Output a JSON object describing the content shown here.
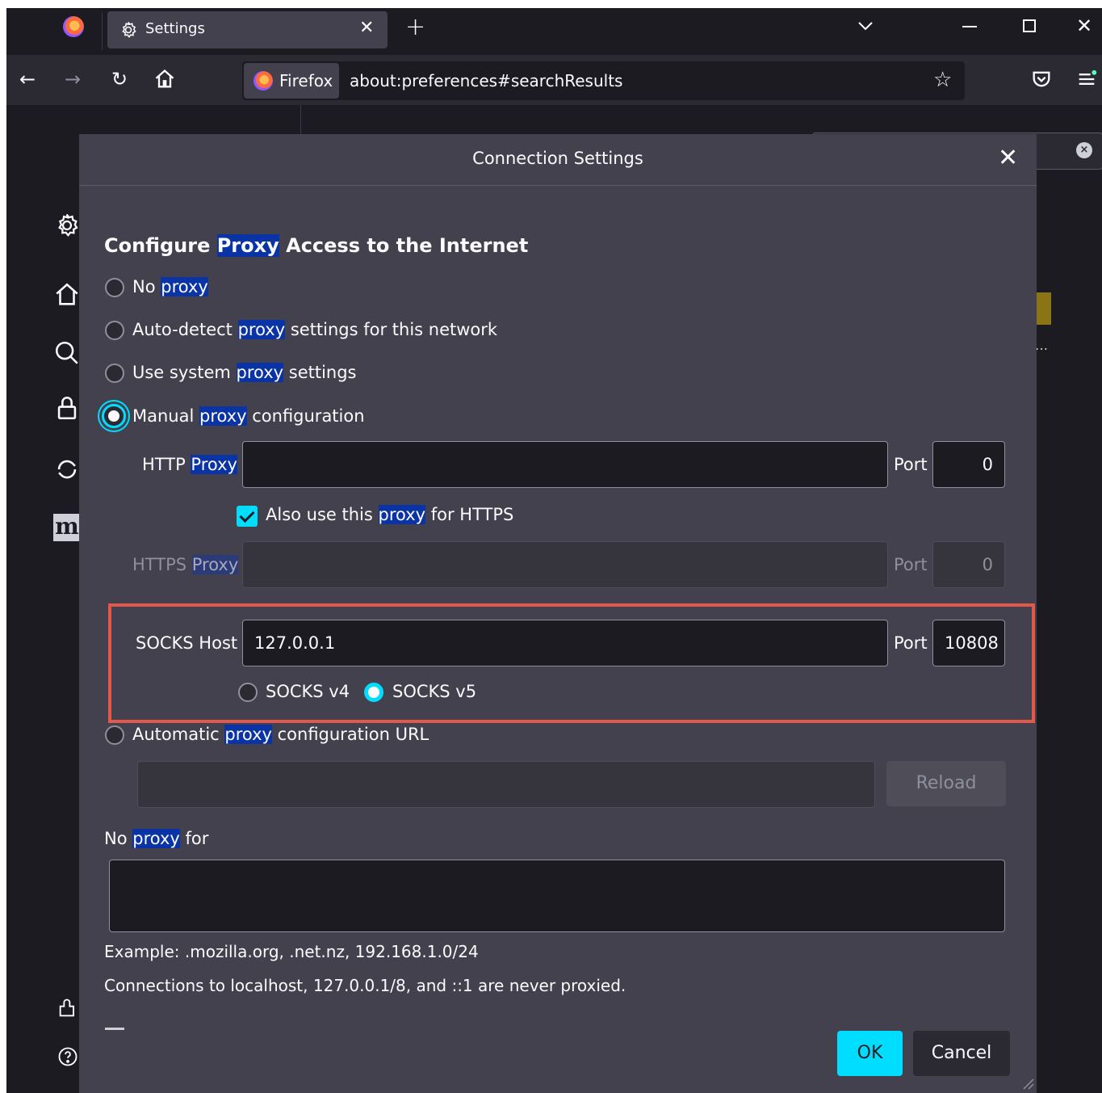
{
  "browser": {
    "tab_title": "Settings",
    "identity_label": "Firefox",
    "url": "about:preferences#searchResults"
  },
  "dialog": {
    "title": "Connection Settings",
    "heading": {
      "pre": "Configure ",
      "hl": "Proxy",
      "post": " Access to the Internet"
    },
    "no_proxy": {
      "pre": "No ",
      "hl": "proxy"
    },
    "auto_detect": {
      "pre": "Auto-detect ",
      "hl": "proxy",
      "post": " settings for this network"
    },
    "use_system": {
      "pre": "Use system ",
      "hl": "proxy",
      "post": " settings"
    },
    "manual": {
      "pre": "Manual ",
      "hl": "proxy",
      "post": " configuration",
      "selected": true
    },
    "http_proxy": {
      "pre": "HTTP ",
      "hl": "Proxy",
      "value": "",
      "port_label": "Port",
      "port": "0"
    },
    "also_https": {
      "pre": "Also use this ",
      "hl": "proxy",
      "post": " for HTTPS",
      "checked": true
    },
    "https_proxy": {
      "pre": "HTTPS ",
      "hl": "Proxy",
      "value": "",
      "port_label": "Port",
      "port": "0"
    },
    "socks": {
      "label": "SOCKS Host",
      "value": "127.0.0.1",
      "port_label": "Port",
      "port": "10808",
      "v4": "SOCKS v4",
      "v5": "SOCKS v5",
      "selected": "v5"
    },
    "auto_url": {
      "pre": "Automatic ",
      "hl": "proxy",
      "post": " configuration URL",
      "value": "",
      "reload": "Reload"
    },
    "no_proxy_for": {
      "pre": "No ",
      "hl": "proxy",
      "post": " for",
      "value": ""
    },
    "example": "Example: .mozilla.org, .net.nz, 192.168.1.0/24",
    "localhost_note": "Connections to localhost, 127.0.0.1/8, and ::1 are never proxied.",
    "ok": "OK",
    "cancel": "Cancel"
  },
  "colors": {
    "accent": "#00ddff",
    "highlight": "#0a34a5",
    "annotation": "#e2584a"
  }
}
